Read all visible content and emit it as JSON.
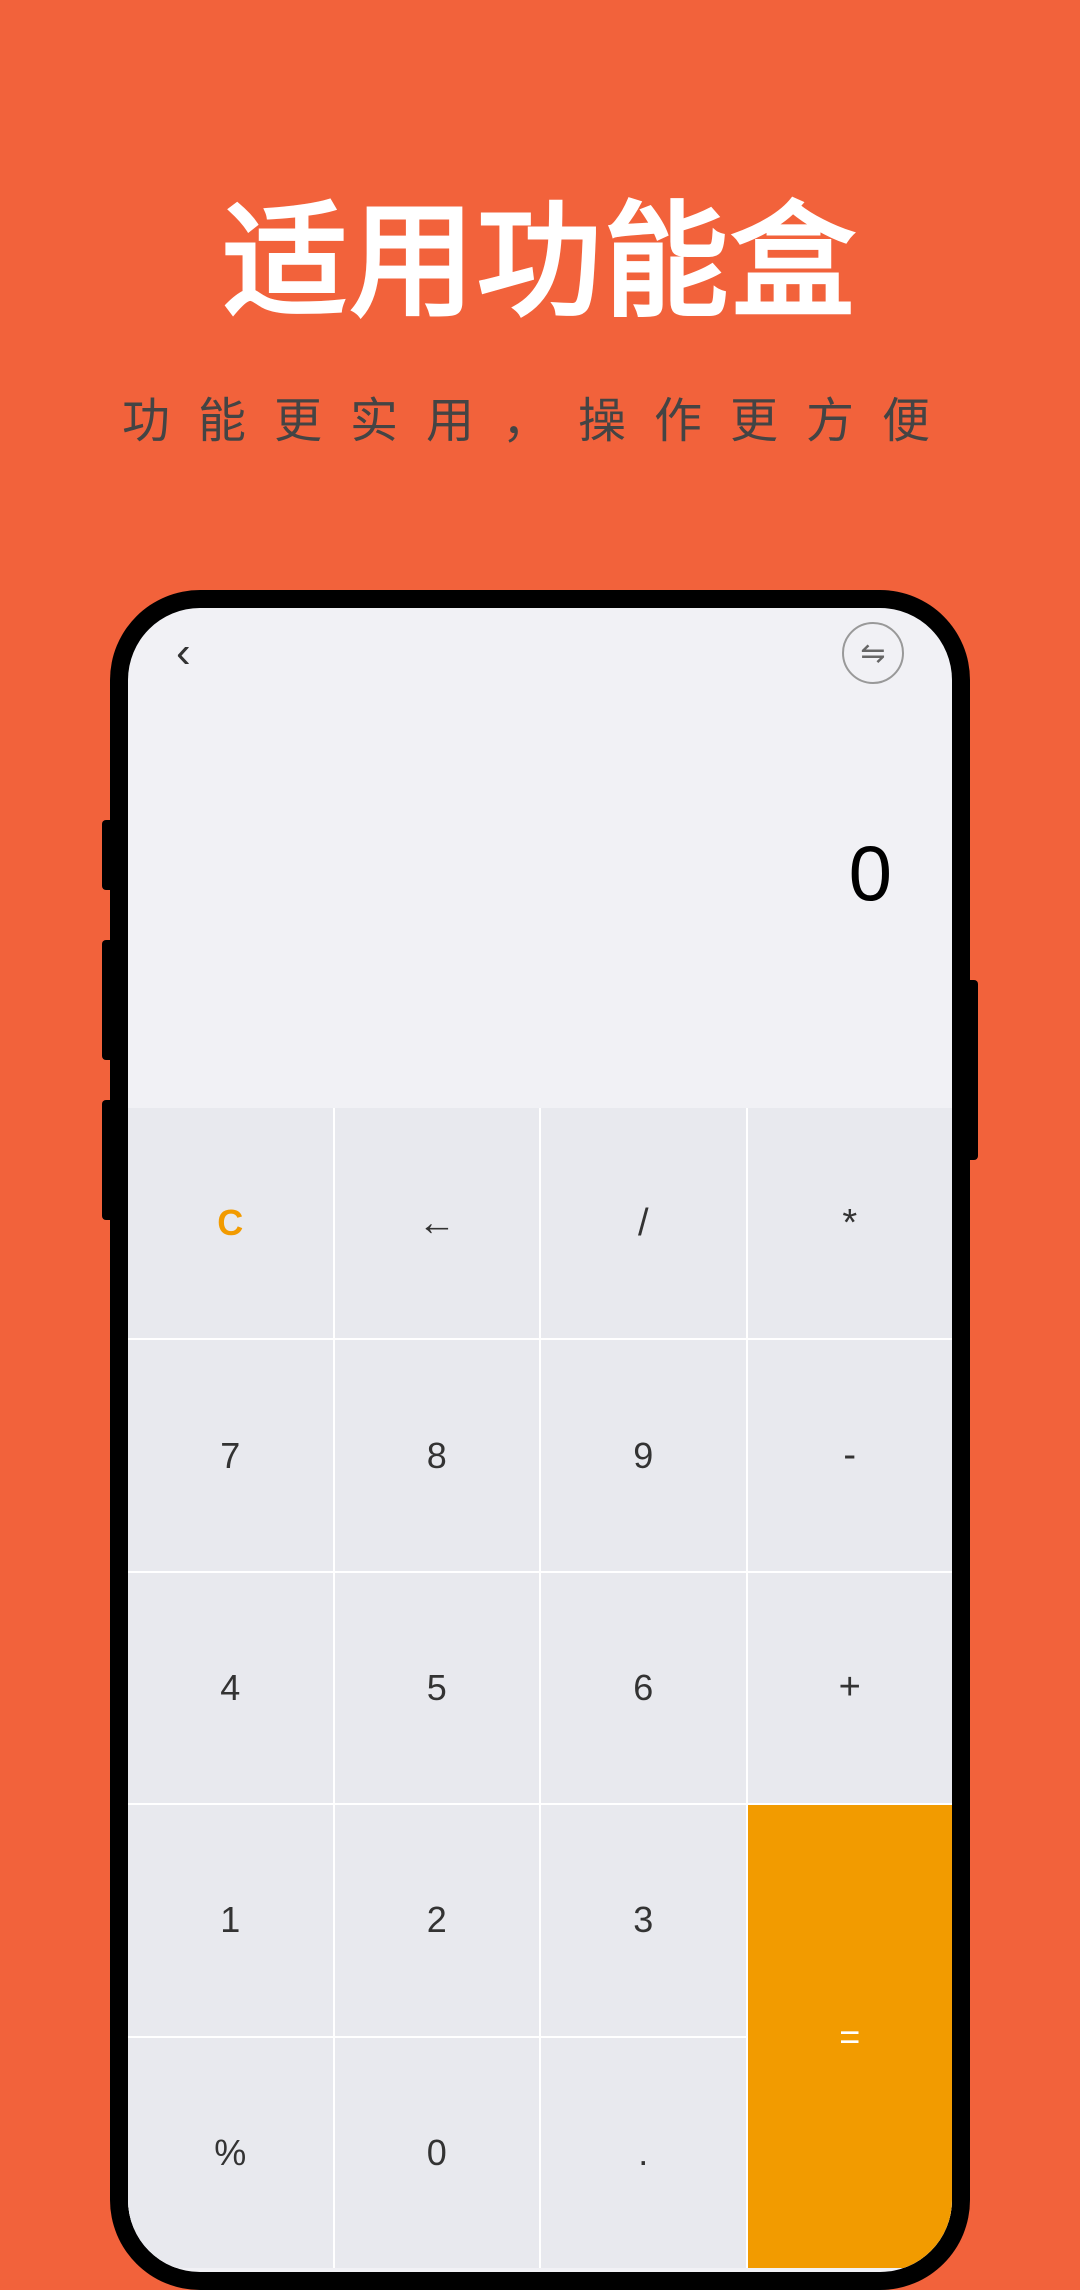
{
  "promo": {
    "title": "适用功能盒",
    "subtitle": "功能更实用，操作更方便"
  },
  "calculator": {
    "display": "0",
    "keys": {
      "clear": "C",
      "backspace": "←",
      "divide": "/",
      "multiply": "*",
      "seven": "7",
      "eight": "8",
      "nine": "9",
      "minus": "-",
      "four": "4",
      "five": "5",
      "six": "6",
      "plus": "+",
      "one": "1",
      "two": "2",
      "three": "3",
      "equals": "=",
      "percent": "%",
      "zero": "0",
      "dot": "."
    },
    "icons": {
      "back": "‹",
      "swap": "⇋"
    }
  }
}
